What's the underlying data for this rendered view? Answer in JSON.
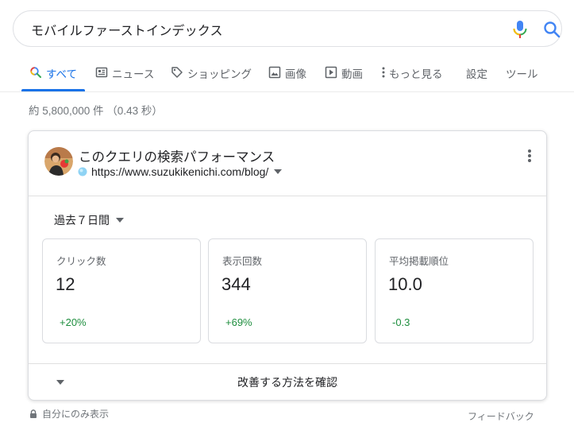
{
  "search": {
    "query": "モバイルファーストインデックス",
    "mic_icon": "mic-icon",
    "search_icon": "search-icon"
  },
  "tabs": [
    {
      "label": "すべて",
      "icon": "search-icon",
      "active": true
    },
    {
      "label": "ニュース",
      "icon": "news-icon"
    },
    {
      "label": "ショッピング",
      "icon": "tag-icon"
    },
    {
      "label": "画像",
      "icon": "image-icon"
    },
    {
      "label": "動画",
      "icon": "play-icon"
    },
    {
      "label": "もっと見る",
      "icon": "more-vert-icon"
    },
    {
      "label": "設定"
    },
    {
      "label": "ツール"
    }
  ],
  "result_stats": "約 5,800,000 件 （0.43 秒）",
  "card": {
    "title": "このクエリの検索パフォーマンス",
    "site": "https://www.suzukikenichi.com/blog/",
    "period": "過去７日間",
    "metrics": [
      {
        "label": "クリック数",
        "value": "12",
        "delta": "+20%"
      },
      {
        "label": "表示回数",
        "value": "344",
        "delta": "+69%"
      },
      {
        "label": "平均掲載順位",
        "value": "10.0",
        "delta": "-0.3"
      }
    ],
    "improve_label": "改善する方法を確認"
  },
  "footer": {
    "private_label": "自分にのみ表示",
    "feedback_label": "フィードバック"
  },
  "colors": {
    "accent": "#1a73e8",
    "positive": "#1e8e3e",
    "muted": "#70757a"
  }
}
